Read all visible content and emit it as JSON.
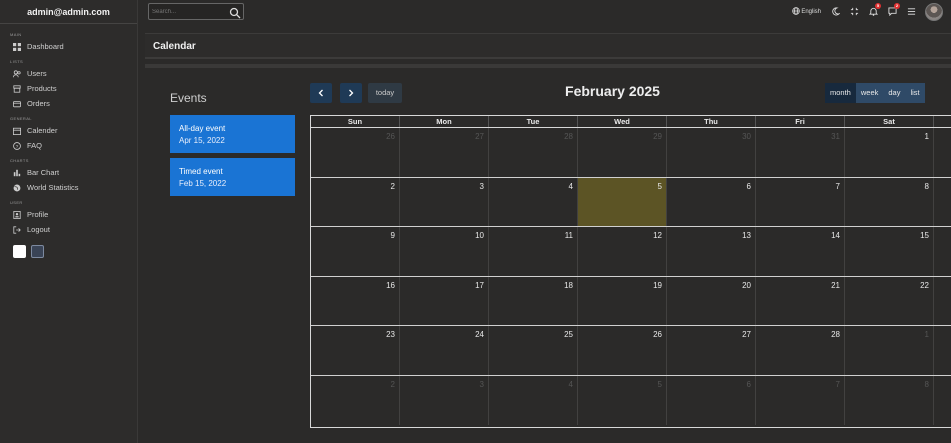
{
  "sidebar": {
    "user": "admin@admin.com",
    "sections": [
      {
        "title": "MAIN",
        "items": [
          {
            "label": "Dashboard",
            "icon": "grid-icon"
          }
        ]
      },
      {
        "title": "LISTS",
        "items": [
          {
            "label": "Users",
            "icon": "users-icon"
          },
          {
            "label": "Products",
            "icon": "store-icon"
          },
          {
            "label": "Orders",
            "icon": "card-icon"
          }
        ]
      },
      {
        "title": "GENERAL",
        "items": [
          {
            "label": "Calender",
            "icon": "calendar-icon"
          },
          {
            "label": "FAQ",
            "icon": "help-circle-icon"
          }
        ]
      },
      {
        "title": "CHARTS",
        "items": [
          {
            "label": "Bar Chart",
            "icon": "bar-chart-icon"
          },
          {
            "label": "World Statistics",
            "icon": "globe-icon"
          }
        ]
      },
      {
        "title": "USER",
        "items": [
          {
            "label": "Profile",
            "icon": "profile-icon"
          },
          {
            "label": "Logout",
            "icon": "logout-icon"
          }
        ]
      }
    ],
    "theme_swatches": [
      {
        "name": "light",
        "color": "#ffffff"
      },
      {
        "name": "dark",
        "color": "#3a4456"
      }
    ]
  },
  "topbar": {
    "search_placeholder": "Search...",
    "language": "English",
    "notifications_count": "5",
    "messages_count": "2"
  },
  "page": {
    "title": "Calendar"
  },
  "events": {
    "title": "Events",
    "items": [
      {
        "title": "All-day event",
        "date": "Apr 15, 2022"
      },
      {
        "title": "Timed event",
        "date": "Feb 15, 2022"
      }
    ]
  },
  "calendar": {
    "title": "February 2025",
    "today_label": "today",
    "views": [
      "month",
      "week",
      "day",
      "list"
    ],
    "active_view": "month",
    "weekdays": [
      "Sun",
      "Mon",
      "Tue",
      "Wed",
      "Thu",
      "Fri",
      "Sat"
    ],
    "weeks": [
      [
        {
          "d": "26",
          "o": true
        },
        {
          "d": "27",
          "o": true
        },
        {
          "d": "28",
          "o": true
        },
        {
          "d": "29",
          "o": true
        },
        {
          "d": "30",
          "o": true
        },
        {
          "d": "31",
          "o": true
        },
        {
          "d": "1",
          "o": false
        }
      ],
      [
        {
          "d": "2",
          "o": false
        },
        {
          "d": "3",
          "o": false
        },
        {
          "d": "4",
          "o": false
        },
        {
          "d": "5",
          "o": false,
          "today": true
        },
        {
          "d": "6",
          "o": false
        },
        {
          "d": "7",
          "o": false
        },
        {
          "d": "8",
          "o": false
        }
      ],
      [
        {
          "d": "9",
          "o": false
        },
        {
          "d": "10",
          "o": false
        },
        {
          "d": "11",
          "o": false
        },
        {
          "d": "12",
          "o": false
        },
        {
          "d": "13",
          "o": false
        },
        {
          "d": "14",
          "o": false
        },
        {
          "d": "15",
          "o": false
        }
      ],
      [
        {
          "d": "16",
          "o": false
        },
        {
          "d": "17",
          "o": false
        },
        {
          "d": "18",
          "o": false
        },
        {
          "d": "19",
          "o": false
        },
        {
          "d": "20",
          "o": false
        },
        {
          "d": "21",
          "o": false
        },
        {
          "d": "22",
          "o": false
        }
      ],
      [
        {
          "d": "23",
          "o": false
        },
        {
          "d": "24",
          "o": false
        },
        {
          "d": "25",
          "o": false
        },
        {
          "d": "26",
          "o": false
        },
        {
          "d": "27",
          "o": false
        },
        {
          "d": "28",
          "o": false
        },
        {
          "d": "1",
          "o": true
        }
      ],
      [
        {
          "d": "2",
          "o": true
        },
        {
          "d": "3",
          "o": true
        },
        {
          "d": "4",
          "o": true
        },
        {
          "d": "5",
          "o": true
        },
        {
          "d": "6",
          "o": true
        },
        {
          "d": "7",
          "o": true
        },
        {
          "d": "8",
          "o": true
        }
      ]
    ]
  },
  "colors": {
    "accent": "#1a74d4",
    "today_bg": "#5c5425",
    "nav_btn": "#1f3a56"
  }
}
